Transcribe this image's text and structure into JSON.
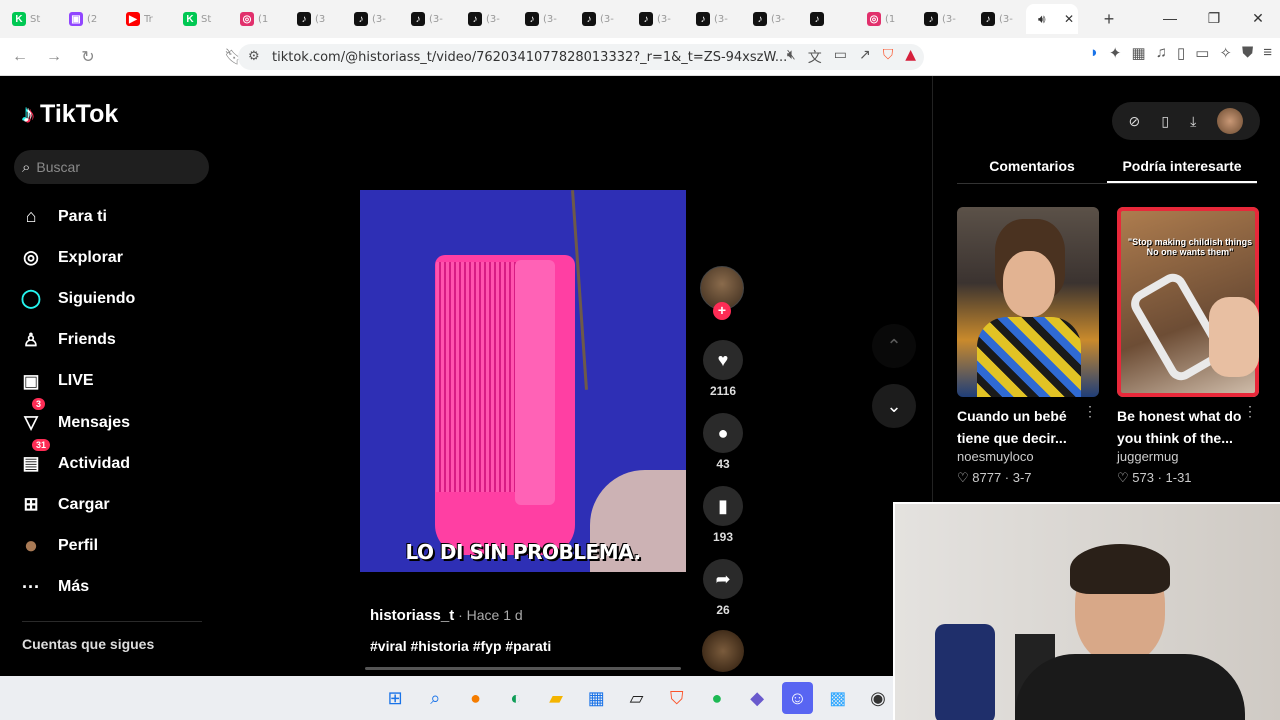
{
  "tabs": [
    {
      "fav": "K",
      "color": "#00c853",
      "text": "St"
    },
    {
      "fav": "▣",
      "color": "#9146ff",
      "text": "(2"
    },
    {
      "fav": "▶",
      "color": "#ff0000",
      "text": "Tr"
    },
    {
      "fav": "K",
      "color": "#00c853",
      "text": "St"
    },
    {
      "fav": "◎",
      "color": "#e1306c",
      "text": "(1"
    },
    {
      "fav": "♪",
      "color": "#111111",
      "text": "(3"
    },
    {
      "fav": "♪",
      "color": "#111111",
      "text": "(3-"
    },
    {
      "fav": "♪",
      "color": "#111111",
      "text": "(3-"
    },
    {
      "fav": "♪",
      "color": "#111111",
      "text": "(3-"
    },
    {
      "fav": "♪",
      "color": "#111111",
      "text": "(3-"
    },
    {
      "fav": "♪",
      "color": "#111111",
      "text": "(3-"
    },
    {
      "fav": "♪",
      "color": "#111111",
      "text": "(3-"
    },
    {
      "fav": "♪",
      "color": "#111111",
      "text": "(3-"
    },
    {
      "fav": "♪",
      "color": "#111111",
      "text": "(3-"
    },
    {
      "fav": "♪",
      "color": "#111111",
      "text": ""
    },
    {
      "fav": "◎",
      "color": "#e1306c",
      "text": "(1"
    },
    {
      "fav": "♪",
      "color": "#111111",
      "text": "(3-"
    },
    {
      "fav": "♪",
      "color": "#111111",
      "text": "(3-"
    }
  ],
  "browser": {
    "url": "tiktok.com/@historiass_t/video/7620341077828013332?_r=1&_t=ZS-94xszW...",
    "new_tab": "+",
    "active_close": "✕"
  },
  "sidebar": {
    "logo": "TikTok",
    "search_placeholder": "Buscar",
    "nav": [
      {
        "icon": "home-icon",
        "glyph": "⌂",
        "label": "Para ti"
      },
      {
        "icon": "compass-icon",
        "glyph": "◎",
        "label": "Explorar"
      },
      {
        "icon": "following-icon",
        "glyph": "◯",
        "label": "Siguiendo"
      },
      {
        "icon": "friends-icon",
        "glyph": "♙",
        "label": "Friends"
      },
      {
        "icon": "live-icon",
        "glyph": "▣",
        "label": "LIVE"
      },
      {
        "icon": "messages-icon",
        "glyph": "▽",
        "label": "Mensajes",
        "badge": "3"
      },
      {
        "icon": "activity-icon",
        "glyph": "▤",
        "label": "Actividad",
        "badge": "31"
      },
      {
        "icon": "upload-icon",
        "glyph": "⊞",
        "label": "Cargar"
      },
      {
        "icon": "profile-avatar-icon",
        "glyph": "●",
        "label": "Perfil"
      },
      {
        "icon": "more-icon",
        "glyph": "···",
        "label": "Más"
      }
    ],
    "following_heading": "Cuentas que sigues"
  },
  "video": {
    "caption": "LO DI SIN PROBLEMA.",
    "author": "historiass_t",
    "posted": " · Hace 1 d",
    "hashtags": "#viral #historia #fyp #parati",
    "likes": "2116",
    "comments": "43",
    "saves": "193",
    "shares": "26"
  },
  "right_panel": {
    "tabs": [
      "Comentarios",
      "Podría interesarte"
    ],
    "selected_tab": 1,
    "cards": [
      {
        "title": "Cuando un bebé tiene que decir...",
        "author": "noesmuyloco",
        "stats": "♡ 8777 · 3-7",
        "overlay": ""
      },
      {
        "title": "Be honest what do you think of the...",
        "author": "juggermug",
        "stats": "♡ 573 · 1-31",
        "overlay": "\"Stop making childish things No one wants them\""
      }
    ]
  }
}
